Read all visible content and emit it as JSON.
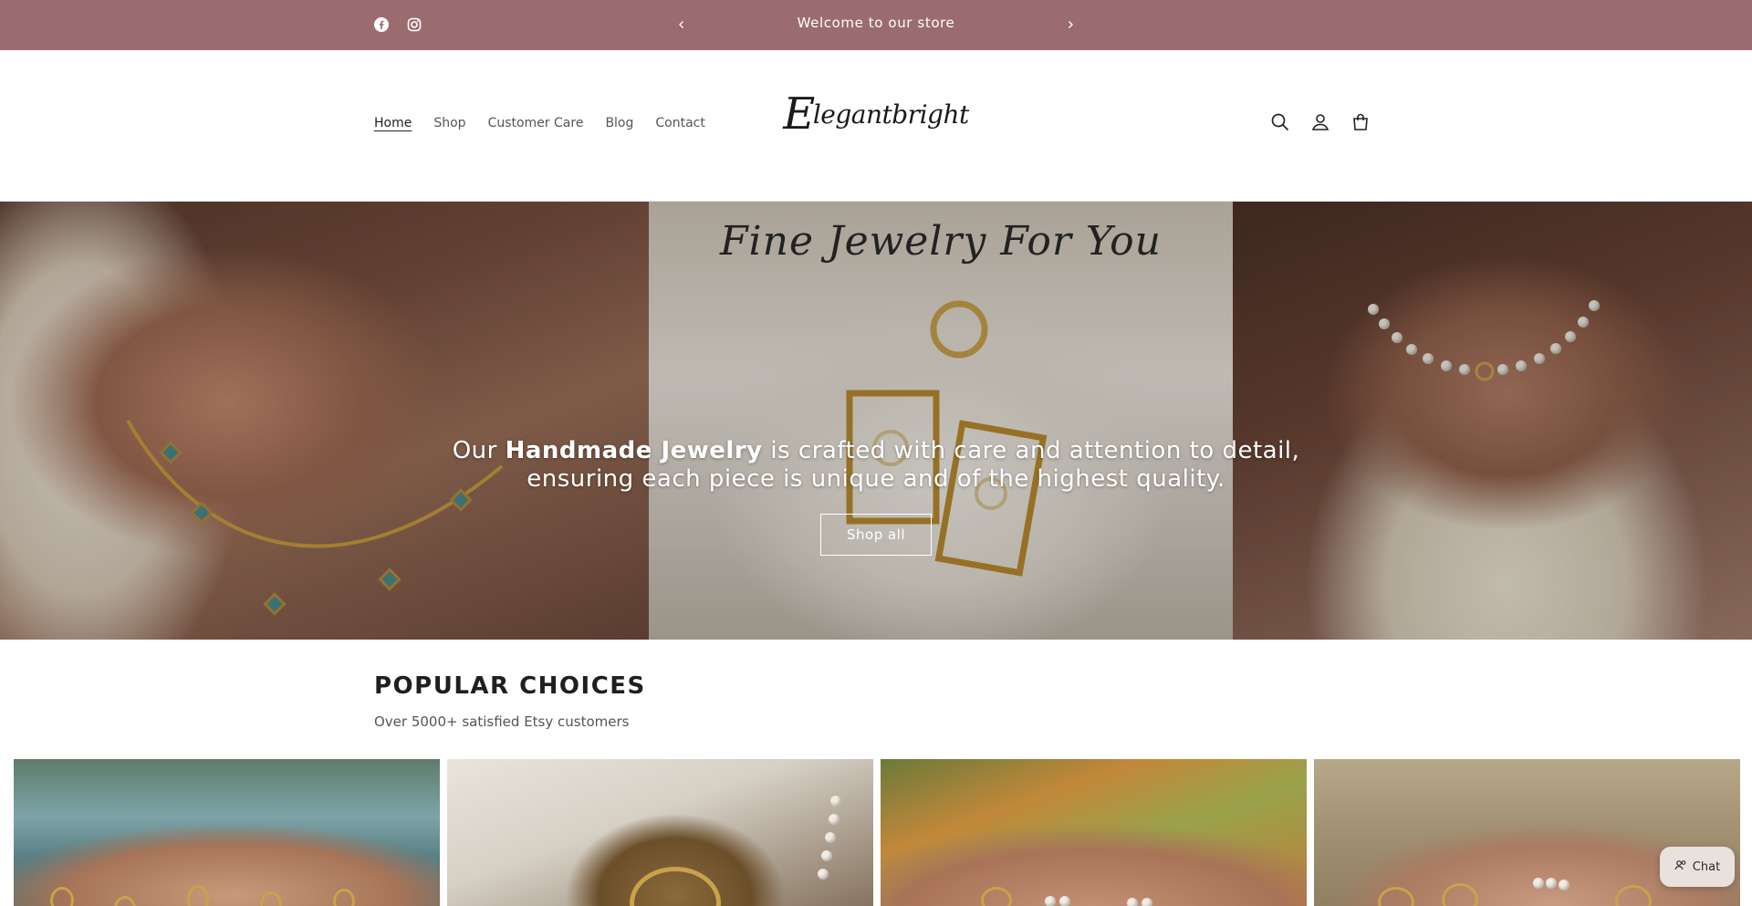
{
  "announcement": {
    "message": "Welcome to our store",
    "social_icons": [
      "facebook-icon",
      "instagram-icon"
    ],
    "prev_icon": "chevron-left-icon",
    "next_icon": "chevron-right-icon",
    "background": "#9a6c70"
  },
  "header": {
    "nav": [
      {
        "label": "Home",
        "active": true
      },
      {
        "label": "Shop",
        "active": false
      },
      {
        "label": "Customer Care",
        "active": false
      },
      {
        "label": "Blog",
        "active": false
      },
      {
        "label": "Contact",
        "active": false
      }
    ],
    "logo_initial": "E",
    "logo_rest": "legantbright",
    "icons": [
      "search-icon",
      "account-icon",
      "cart-icon"
    ]
  },
  "hero": {
    "script_title": "Fine Jewelry For You",
    "text_prefix": "Our ",
    "text_bold": "Handmade Jewelry",
    "text_suffix": " is crafted with care and attention to detail, ensuring each piece is unique and of the highest quality.",
    "button_label": "Shop all"
  },
  "popular": {
    "title": "POPULAR CHOICES",
    "subtitle": "Over 5000+ satisfied Etsy customers"
  },
  "chat": {
    "label": "Chat",
    "icon": "chat-icon"
  }
}
